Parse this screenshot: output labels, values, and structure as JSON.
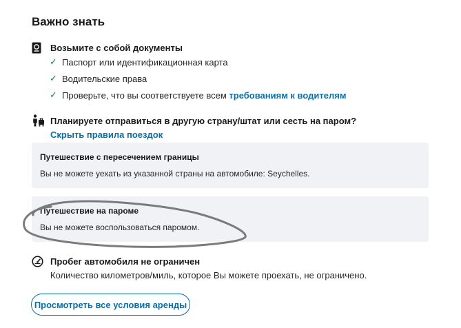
{
  "title": "Важно знать",
  "documents": {
    "heading": "Возьмите с собой документы",
    "items": [
      {
        "text": "Паспорт или идентификационная карта"
      },
      {
        "text": "Водительские права"
      },
      {
        "text": "Проверьте, что вы соответствуете всем ",
        "link": "требованиям к водителям"
      }
    ]
  },
  "travel": {
    "heading": "Планируете отправиться в другую страну/штат или сесть на паром?",
    "toggle_link": "Скрыть правила поездок",
    "border": {
      "title": "Путешествие с пересечением границы",
      "text": "Вы не можете уехать из указанной страны на автомобиле: Seychelles."
    },
    "ferry": {
      "title": "Путешествие на пароме",
      "text": "Вы не можете воспользоваться паромом."
    }
  },
  "mileage": {
    "heading": "Пробег автомобиля не ограничен",
    "text": "Количество километров/миль, которое Вы можете проехать, не ограничено."
  },
  "button_label": "Просмотреть все условия аренды",
  "colors": {
    "link": "#0b6fa4",
    "check": "#0a8a3c",
    "box_bg": "#f1f2f5"
  }
}
